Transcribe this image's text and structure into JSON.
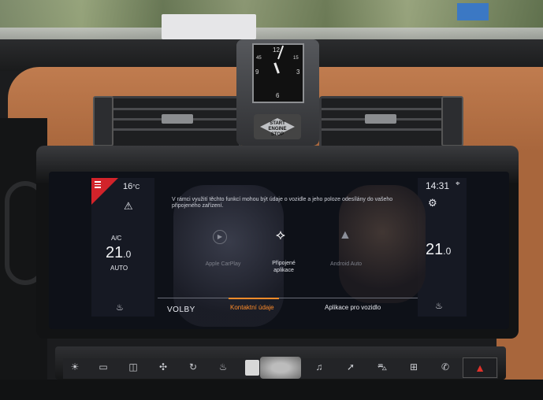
{
  "clock": {
    "twelve": "12",
    "three": "3",
    "six": "6",
    "nine": "9",
    "fortyfive": "45",
    "fifteen": "15"
  },
  "engine_button": {
    "line1": "START",
    "line2": "ENGINE",
    "line3": "STOP"
  },
  "status": {
    "outside_temp": "16",
    "temp_unit": "°C",
    "time": "14:31"
  },
  "notice": "V rámci využití těchto funkcí mohou být údaje o vozidle a jeho poloze odesílány do vašeho připojeného zařízení.",
  "climate": {
    "left": {
      "ac_label": "A/C",
      "temp": "21",
      "temp_decimal": ".0",
      "mode": "AUTO"
    },
    "right": {
      "temp": "21",
      "temp_decimal": ".0"
    }
  },
  "apps": [
    {
      "label": "Apple CarPlay",
      "icon": "play-icon"
    },
    {
      "label_line1": "Připojené",
      "label_line2": "aplikace",
      "icon": "connected-apps-icon"
    },
    {
      "label": "Android Auto",
      "icon": "android-auto-icon"
    }
  ],
  "bottom_tabs": {
    "volby": "VOLBY",
    "contacts": "Kontaktní údaje",
    "vehicle_apps": "Aplikace pro vozidlo"
  },
  "controls": [
    "sun-icon",
    "rear-defrost-icon",
    "front-defrost-icon",
    "fan-icon",
    "recirculation-icon",
    "seat-heat-icon",
    "knob",
    "music-icon",
    "navigation-icon",
    "car-icon",
    "apps-grid-icon",
    "phone-icon",
    "hazard-icon"
  ],
  "colors": {
    "accent": "#ff8c2a",
    "menu_red": "#d2232a",
    "screen_bg": "#0e1118"
  }
}
